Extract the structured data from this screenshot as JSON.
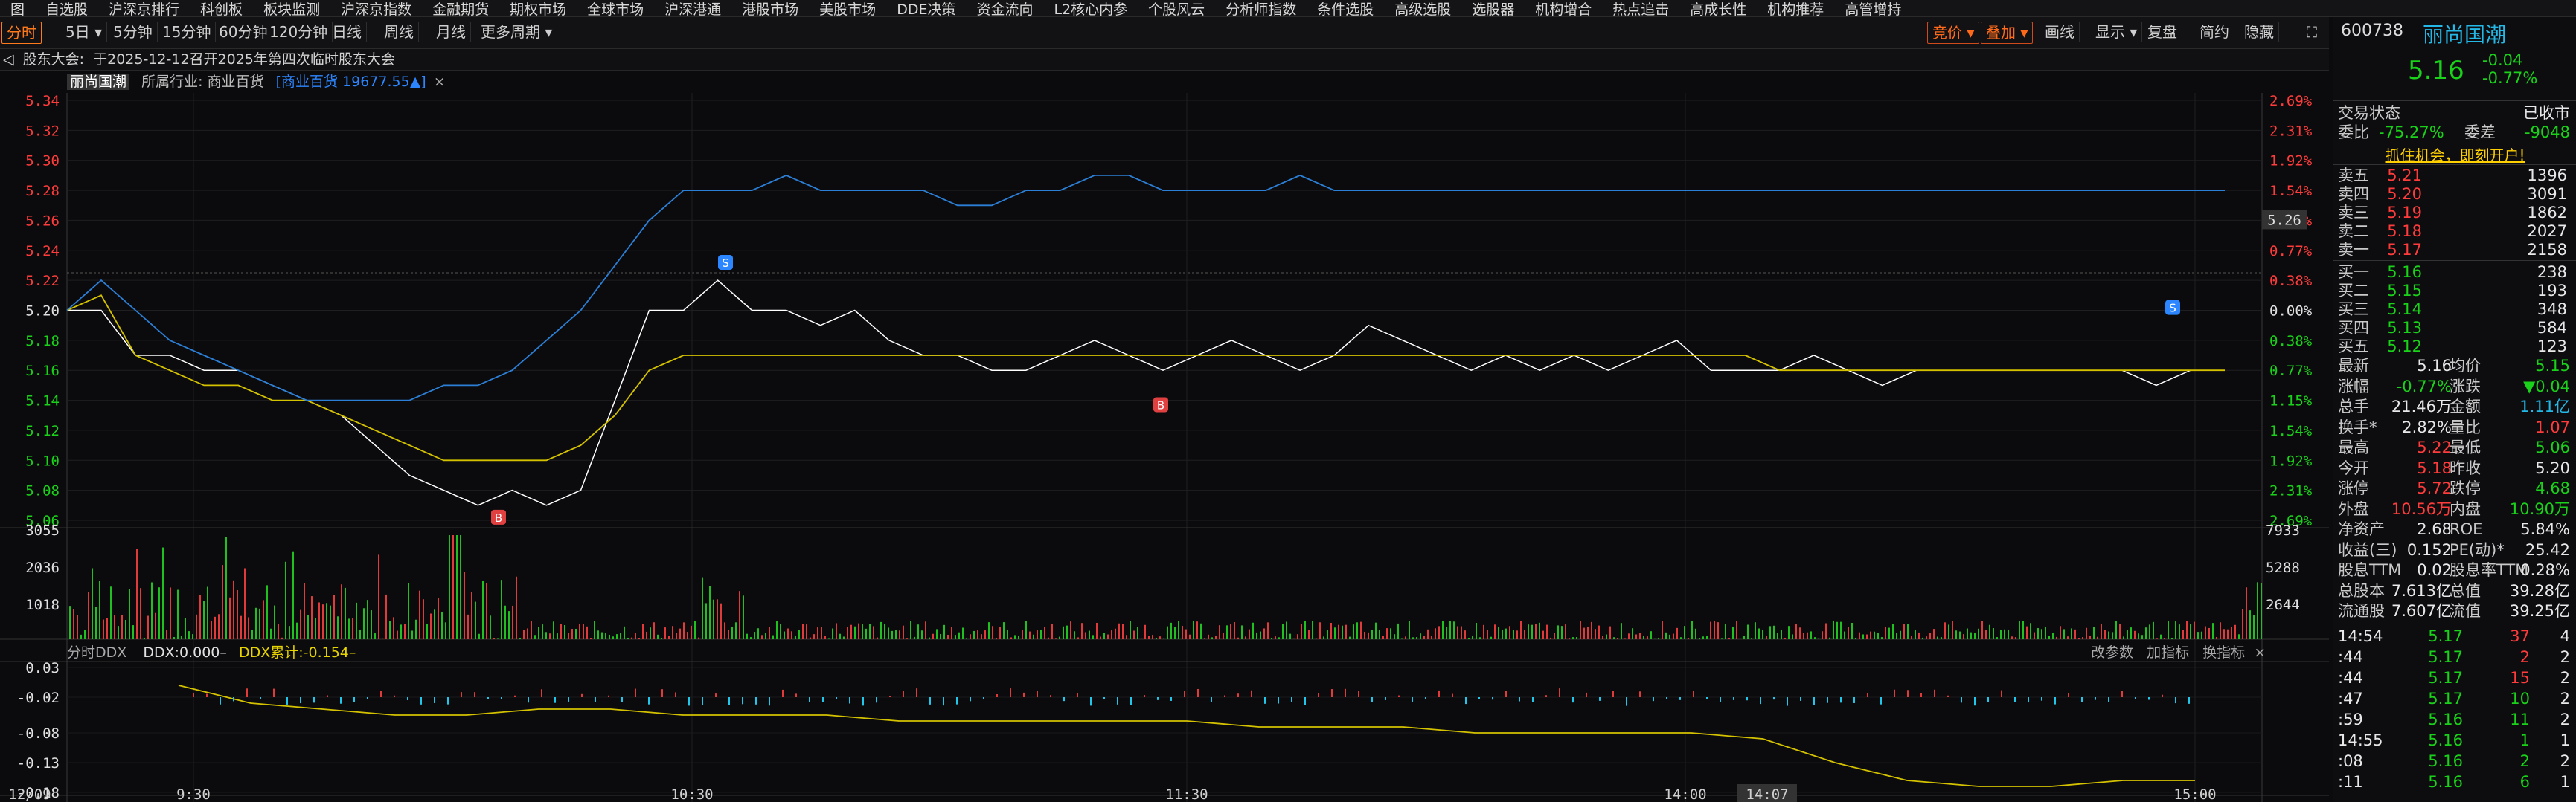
{
  "topnav": [
    "图",
    "自选股",
    "沪深京排行",
    "科创板",
    "板块监测",
    "沪深京指数",
    "金融期货",
    "期权市场",
    "全球市场",
    "沪深港通",
    "港股市场",
    "美股市场",
    "DDE决策",
    "资金流向",
    "L2核心内参",
    "个股风云",
    "分析师指数",
    "条件选股",
    "高级选股",
    "选股器",
    "机构增合",
    "热点追击",
    "高成长性",
    "机构推荐",
    "高管增持"
  ],
  "toolbar": {
    "left": [
      "分时",
      "5日",
      "5分钟",
      "15分钟",
      "60分钟",
      "120分钟",
      "日线",
      "周线",
      "月线",
      "更多周期"
    ],
    "right": [
      "竞价",
      "叠加",
      "画线",
      "显示",
      "复盘",
      "简约",
      "隐藏"
    ]
  },
  "notice": {
    "label": "股东大会:",
    "text": "于2025-12-12召开2025年第四次临时股东大会"
  },
  "infobar": {
    "name": "丽尚国潮",
    "industry_label": "所属行业:",
    "industry": "商业百货",
    "index_label": "[商业百货 19677.55▲]"
  },
  "chart_data": {
    "type": "line",
    "series": [
      {
        "values": [
          5.2,
          5.2,
          5.17,
          5.17,
          5.16,
          5.16,
          5.15,
          5.14,
          5.13,
          5.11,
          5.09,
          5.08,
          5.07,
          5.08,
          5.07,
          5.08,
          5.14,
          5.2,
          5.2,
          5.22,
          5.2,
          5.2,
          5.19,
          5.2,
          5.18,
          5.17,
          5.17,
          5.16,
          5.16,
          5.17,
          5.18,
          5.17,
          5.16,
          5.17,
          5.18,
          5.17,
          5.16,
          5.17,
          5.19,
          5.18,
          5.17,
          5.16,
          5.17,
          5.16,
          5.17,
          5.16,
          5.17,
          5.18,
          5.16,
          5.16,
          5.16,
          5.17,
          5.16,
          5.15,
          5.16,
          5.16,
          5.16,
          5.16,
          5.16,
          5.16,
          5.16,
          5.15,
          5.16,
          5.16
        ]
      },
      {
        "values": [
          5.2,
          5.21,
          5.17,
          5.16,
          5.15,
          5.15,
          5.14,
          5.14,
          5.13,
          5.12,
          5.11,
          5.1,
          5.1,
          5.1,
          5.1,
          5.11,
          5.13,
          5.16,
          5.17,
          5.17,
          5.17,
          5.17,
          5.17,
          5.17,
          5.17,
          5.17,
          5.17,
          5.17,
          5.17,
          5.17,
          5.17,
          5.17,
          5.17,
          5.17,
          5.17,
          5.17,
          5.17,
          5.17,
          5.17,
          5.17,
          5.17,
          5.17,
          5.17,
          5.17,
          5.17,
          5.17,
          5.17,
          5.17,
          5.17,
          5.17,
          5.16,
          5.16,
          5.16,
          5.16,
          5.16,
          5.16,
          5.16,
          5.16,
          5.16,
          5.16,
          5.16,
          5.16,
          5.16,
          5.16
        ]
      },
      {
        "values": [
          5.2,
          5.22,
          5.2,
          5.18,
          5.17,
          5.16,
          5.15,
          5.14,
          5.14,
          5.14,
          5.14,
          5.15,
          5.15,
          5.16,
          5.18,
          5.2,
          5.23,
          5.26,
          5.28,
          5.28,
          5.28,
          5.29,
          5.28,
          5.28,
          5.28,
          5.28,
          5.27,
          5.27,
          5.28,
          5.28,
          5.29,
          5.29,
          5.28,
          5.28,
          5.28,
          5.28,
          5.29,
          5.28,
          5.28,
          5.28,
          5.28,
          5.28,
          5.28,
          5.28,
          5.28,
          5.28,
          5.28,
          5.28,
          5.28,
          5.28,
          5.28,
          5.28,
          5.28,
          5.28,
          5.28,
          5.28,
          5.28,
          5.28,
          5.28,
          5.28,
          5.28,
          5.28,
          5.28,
          5.28
        ]
      }
    ],
    "price_ticks": [
      "5.34",
      "5.32",
      "5.30",
      "5.28",
      "5.26",
      "5.24",
      "5.22",
      "5.20",
      "5.18",
      "5.16",
      "5.14",
      "5.12",
      "5.10",
      "5.08",
      "5.06"
    ],
    "pct_ticks": [
      "2.69%",
      "2.31%",
      "1.92%",
      "1.54%",
      "1.15%",
      "0.77%",
      "0.38%",
      "0.00%",
      "0.38%",
      "0.77%",
      "1.15%",
      "1.54%",
      "1.92%",
      "2.31%",
      "2.69%"
    ],
    "current_price_tag": "5.26",
    "vol_ticks_left": [
      "3055",
      "2036",
      "1018"
    ],
    "vol_ticks_right": [
      "7933",
      "5288",
      "2644"
    ],
    "ddx_ticks": [
      "0.03",
      "-0.02",
      "-0.08",
      "-0.13",
      "-0.18"
    ],
    "time_ticks": [
      "12/09",
      "9:30",
      "10:30",
      "11:30",
      "14:00",
      "14:07",
      "15:00"
    ],
    "markers": [
      "S",
      "B",
      "S",
      "B",
      "S"
    ]
  },
  "ddx": {
    "title": "分时DDX",
    "ddx_label": "DDX:0.000–",
    "cum_label": "DDX累计:-0.154–",
    "btns": [
      "改参数",
      "加指标",
      "换指标"
    ]
  },
  "right_panel": {
    "code": "600738",
    "name": "丽尚国潮",
    "price": "5.16",
    "change": "-0.04",
    "change_pct": "-0.77%",
    "status_label": "交易状态",
    "status": "已收市",
    "weibi_label": "委比",
    "weibi": "-75.27%",
    "weicha_label": "委差",
    "weicha": "-9048",
    "ad": "抓住机会，即刻开户!",
    "sell": [
      [
        "卖五",
        "5.21",
        "1396"
      ],
      [
        "卖四",
        "5.20",
        "3091"
      ],
      [
        "卖三",
        "5.19",
        "1862"
      ],
      [
        "卖二",
        "5.18",
        "2027"
      ],
      [
        "卖一",
        "5.17",
        "2158"
      ]
    ],
    "buy": [
      [
        "买一",
        "5.16",
        "238"
      ],
      [
        "买二",
        "5.15",
        "193"
      ],
      [
        "买三",
        "5.14",
        "348"
      ],
      [
        "买四",
        "5.13",
        "584"
      ],
      [
        "买五",
        "5.12",
        "123"
      ]
    ],
    "stats": [
      [
        "最新",
        "5.16",
        "均价",
        "5.15"
      ],
      [
        "涨幅",
        "-0.77%",
        "涨跌",
        "▼0.04"
      ],
      [
        "总手",
        "21.46万",
        "金额",
        "1.11亿"
      ],
      [
        "换手*",
        "2.82%",
        "量比",
        "1.07"
      ],
      [
        "最高",
        "5.22",
        "最低",
        "5.06"
      ],
      [
        "今开",
        "5.18",
        "昨收",
        "5.20"
      ],
      [
        "涨停",
        "5.72",
        "跌停",
        "4.68"
      ],
      [
        "外盘",
        "10.56万",
        "内盘",
        "10.90万"
      ],
      [
        "净资产",
        "2.68",
        "ROE",
        "5.84%"
      ],
      [
        "收益(三)",
        "0.152",
        "PE(动)*",
        "25.42"
      ],
      [
        "股息TTM",
        "0.02",
        "股息率TTM",
        "0.28%"
      ],
      [
        "总股本",
        "7.613亿",
        "总值",
        "39.28亿"
      ],
      [
        "流通股",
        "7.607亿",
        "流值",
        "39.25亿"
      ]
    ],
    "ticks": [
      [
        "14:54",
        "5.17",
        "37",
        "4"
      ],
      [
        ":44",
        "5.17",
        "2",
        "2"
      ],
      [
        ":44",
        "5.17",
        "15",
        "2"
      ],
      [
        ":47",
        "5.17",
        "10",
        "2"
      ],
      [
        ":59",
        "5.16",
        "11",
        "2"
      ],
      [
        "14:55",
        "5.16",
        "1",
        "1"
      ],
      [
        ":08",
        "5.16",
        "2",
        "2"
      ],
      [
        ":11",
        "5.16",
        "6",
        "1"
      ]
    ]
  }
}
